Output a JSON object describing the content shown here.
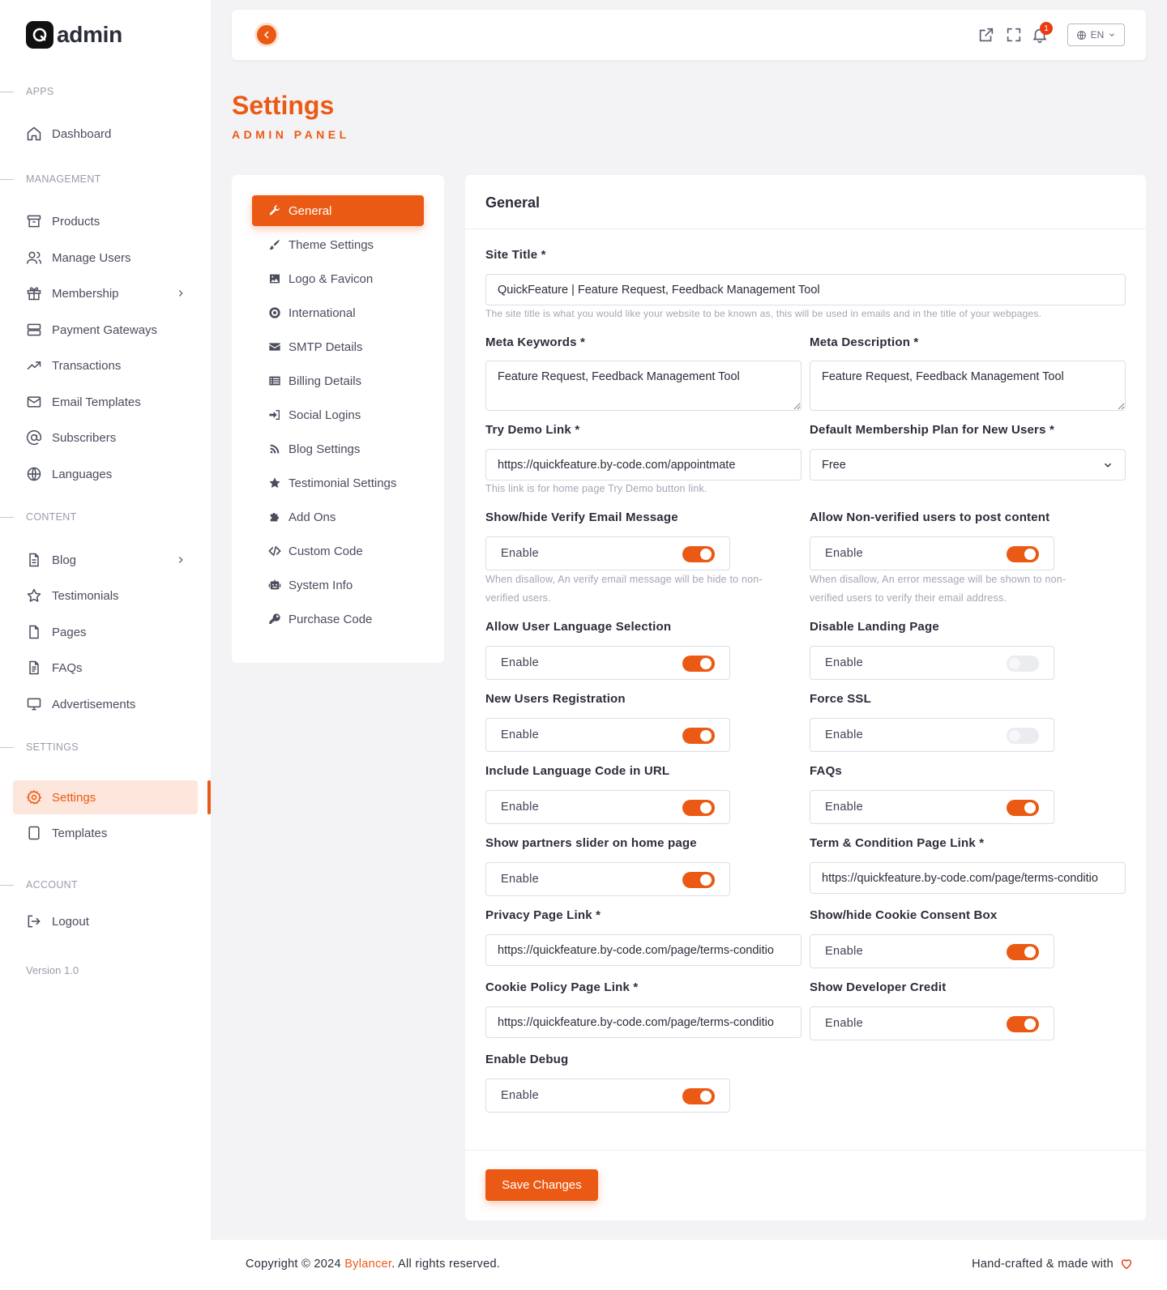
{
  "brand": {
    "name": "admin",
    "logo_letter": "Q"
  },
  "sidebar": {
    "sections": {
      "apps": "APPS",
      "management": "MANAGEMENT",
      "content": "CONTENT",
      "settings": "SETTINGS",
      "account": "ACCOUNT"
    },
    "items": {
      "dashboard": "Dashboard",
      "products": "Products",
      "manage_users": "Manage Users",
      "membership": "Membership",
      "payment_gateways": "Payment Gateways",
      "transactions": "Transactions",
      "email_templates": "Email Templates",
      "subscribers": "Subscribers",
      "languages": "Languages",
      "blog": "Blog",
      "testimonials": "Testimonials",
      "pages": "Pages",
      "faqs": "FAQs",
      "advertisements": "Advertisements",
      "settings": "Settings",
      "templates": "Templates",
      "logout": "Logout"
    },
    "active_item": "Settings",
    "version": "Version 1.0"
  },
  "topbar": {
    "notification_count": "1",
    "language": "EN"
  },
  "page": {
    "title": "Settings",
    "subtitle": "ADMIN PANEL"
  },
  "settings_menu": {
    "active": "General",
    "items": {
      "general": "General",
      "theme_settings": "Theme Settings",
      "logo_favicon": "Logo & Favicon",
      "international": "International",
      "smtp_details": "SMTP Details",
      "billing_details": "Billing Details",
      "social_logins": "Social Logins",
      "blog_settings": "Blog Settings",
      "testimonial_settings": "Testimonial Settings",
      "add_ons": "Add Ons",
      "custom_code": "Custom Code",
      "system_info": "System Info",
      "purchase_code": "Purchase Code"
    }
  },
  "form": {
    "card_title": "General",
    "site_title": {
      "label": "Site Title *",
      "value": "QuickFeature | Feature Request, Feedback Management Tool",
      "help": "The site title is what you would like your website to be known as, this will be used in emails and in the title of your webpages."
    },
    "meta_keywords": {
      "label": "Meta Keywords *",
      "value": "Feature Request, Feedback Management Tool"
    },
    "meta_description": {
      "label": "Meta Description *",
      "value": "Feature Request, Feedback Management Tool"
    },
    "try_demo_link": {
      "label": "Try Demo Link *",
      "value": "https://quickfeature.by-code.com/appointmate",
      "help": "This link is for home page Try Demo button link."
    },
    "default_membership": {
      "label": "Default Membership Plan for New Users *",
      "value": "Free"
    },
    "toggle_label": "Enable",
    "verify_email": {
      "label": "Show/hide Verify Email Message",
      "enabled": true,
      "help_line1": "When disallow, An verify email message will be hide to non-",
      "help_line2": "verified users."
    },
    "non_verified_post": {
      "label": "Allow Non-verified users to post content",
      "enabled": true,
      "help_line1": "When disallow, An error message will be shown to non-",
      "help_line2": "verified users to verify their email address."
    },
    "user_language": {
      "label": "Allow User Language Selection",
      "enabled": true
    },
    "disable_landing": {
      "label": "Disable Landing Page",
      "enabled": false
    },
    "new_registration": {
      "label": "New Users Registration",
      "enabled": true
    },
    "force_ssl": {
      "label": "Force SSL",
      "enabled": false
    },
    "language_code_url": {
      "label": "Include Language Code in URL",
      "enabled": true
    },
    "faqs": {
      "label": "FAQs",
      "enabled": true
    },
    "partners_slider": {
      "label": "Show partners slider on home page",
      "enabled": true
    },
    "terms_link": {
      "label": "Term & Condition Page Link *",
      "value": "https://quickfeature.by-code.com/page/terms-conditio"
    },
    "privacy_link": {
      "label": "Privacy Page Link *",
      "value": "https://quickfeature.by-code.com/page/terms-conditio"
    },
    "cookie_consent": {
      "label": "Show/hide Cookie Consent Box",
      "enabled": true
    },
    "cookie_policy_link": {
      "label": "Cookie Policy Page Link *",
      "value": "https://quickfeature.by-code.com/page/terms-conditio"
    },
    "developer_credit": {
      "label": "Show Developer Credit",
      "enabled": true
    },
    "enable_debug": {
      "label": "Enable Debug",
      "enabled": true
    },
    "save_label": "Save Changes"
  },
  "footer": {
    "copyright_prefix": "Copyright © 2024 ",
    "company": "Bylancer",
    "copyright_suffix": ". All rights reserved.",
    "right_text": "Hand-crafted & made with"
  },
  "colors": {
    "accent": "#eb5a14",
    "accent_light": "#fde6dc"
  }
}
